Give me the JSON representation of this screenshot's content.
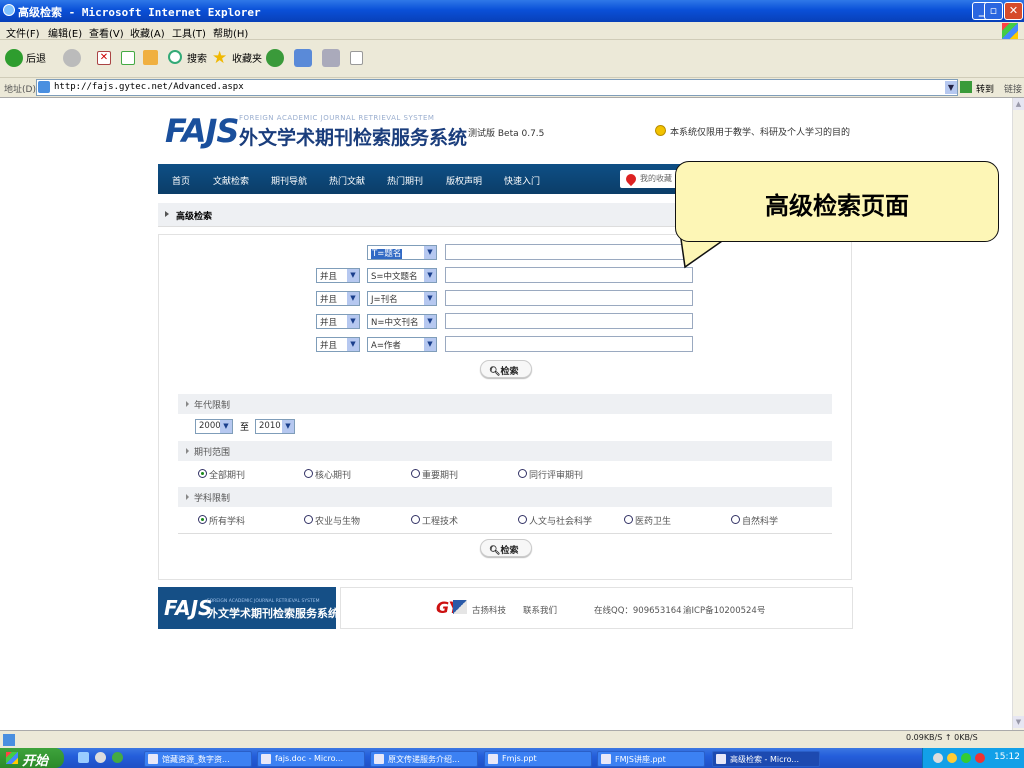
{
  "window": {
    "title": "高级检索 - Microsoft Internet Explorer"
  },
  "menu": [
    "文件(F)",
    "编辑(E)",
    "查看(V)",
    "收藏(A)",
    "工具(T)",
    "帮助(H)"
  ],
  "toolbar": {
    "back": "后退",
    "search": "搜索",
    "favorites": "收藏夹"
  },
  "address": {
    "label": "地址(D)",
    "url": "http://fajs.gytec.net/Advanced.aspx",
    "go": "转到",
    "links": "链接"
  },
  "site": {
    "logo": "FAJS",
    "logo_en": "FOREIGN ACADEMIC JOURNAL RETRIEVAL SYSTEM",
    "logo_cn": "外文学术期刊检索服务系统",
    "version": "测试版 Beta 0.7.5",
    "notice": "本系统仅限用于教学、科研及个人学习的目的"
  },
  "nav": {
    "items": [
      "首页",
      "文献检索",
      "期刊导航",
      "热门文献",
      "热门期刊",
      "版权声明",
      "快速入门"
    ],
    "favorites": "我的收藏"
  },
  "breadcrumb": "高级检索",
  "search": {
    "rows": [
      {
        "op": "",
        "field": "T=题名"
      },
      {
        "op": "并且",
        "field": "S=中文题名"
      },
      {
        "op": "并且",
        "field": "J=刊名"
      },
      {
        "op": "并且",
        "field": "N=中文刊名"
      },
      {
        "op": "并且",
        "field": "A=作者"
      }
    ],
    "button": "检索"
  },
  "year": {
    "title": "年代限制",
    "from": "2000",
    "sep": "至",
    "to": "2010"
  },
  "journal_range": {
    "title": "期刊范围",
    "options": [
      "全部期刊",
      "核心期刊",
      "重要期刊",
      "同行评审期刊"
    ],
    "selected": "全部期刊"
  },
  "subject": {
    "title": "学科限制",
    "options": [
      "所有学科",
      "农业与生物",
      "工程技术",
      "人文与社会科学",
      "医药卫生",
      "自然科学"
    ],
    "selected": "所有学科"
  },
  "search_button_bottom": "检索",
  "footer": {
    "logo": "FAJS",
    "logo_en": "FOREIGN ACADEMIC JOURNAL RETRIEVAL SYSTEM",
    "logo_cn": "外文学术期刊检索服务系统",
    "company_logo": "GY",
    "company": "古扬科技",
    "contact": "联系我们",
    "qq": "在线QQ：909653164",
    "icp": "渝ICP备10200524号"
  },
  "callout": "高级检索页面",
  "status": {
    "speed": "0.09KB/S  ↑  0KB/S"
  },
  "taskbar": {
    "start": "开始",
    "items": [
      "馆藏资源_数字资...",
      "fajs.doc - Micro...",
      "原文传递服务介绍...",
      "Fmjs.ppt",
      "FMJS讲座.ppt",
      "高级检索 - Micro..."
    ],
    "clock": "15:12"
  }
}
